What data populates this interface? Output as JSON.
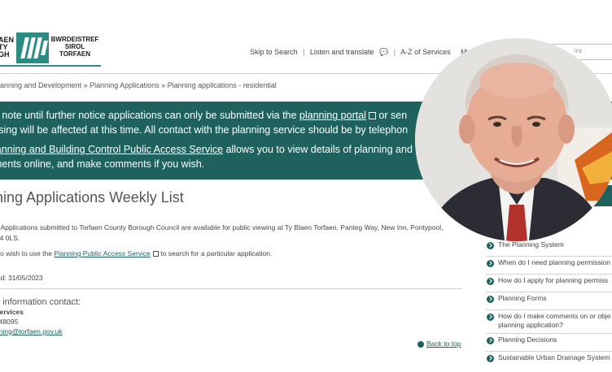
{
  "header": {
    "logo_left_lines": [
      "AEN",
      "TY",
      "GH"
    ],
    "logo_right_lines": [
      "BWRDEISTREF",
      "SIROL",
      "TORFAEN"
    ],
    "utility": {
      "skip": "Skip to Search",
      "listen": "Listen and translate",
      "az": "A-Z of Services",
      "my": "My Torfa"
    },
    "search_placeholder": "ire"
  },
  "breadcrumb": "lanning and Development » Planning Applications » Planning applications - residential",
  "notice": {
    "line1_a": "e note until further notice applications can only be submitted via the ",
    "line1_link": "planning portal",
    "line1_b": " or sen",
    "line2": "ssing will be affected at this time. All contact with the planning service should be by telephon",
    "line3_link": "lanning and Building Control Public Access Service",
    "line3_b": " allows you to view details of planning and b",
    "line4": "ments online, and make comments if you wish."
  },
  "page": {
    "title": "ning Applications Weekly List",
    "para1_line1": "g Applications submitted to Torfaen County Borough Council are available for public viewing at Ty Blaen Torfaen, Panteg Way, New Inn, Pontypool,",
    "para1_line2": "P4 0LS.",
    "para2_a": "lso wish to use the ",
    "para2_link": "Planning Public Access Service",
    "para2_b": " to search for a particular application.",
    "modified": "ied: 31/05/2023",
    "contact_heading": "e information contact:",
    "contact_name": "Services",
    "contact_phone": "648095",
    "contact_email": "nning@torfaen.gov.uk",
    "back_to_top": "Back to top"
  },
  "related": [
    "The Planning System",
    "When do I need planning permission",
    "How do I apply for planning permiss",
    "Planning Forms",
    "How do I make comments on or obje",
    "Planning Decisions",
    "Sustainable Urban Drainage System"
  ],
  "related_second_line": "planning application?",
  "colors": {
    "teal": "#1f625d",
    "logo_teal": "#2a8c83"
  }
}
